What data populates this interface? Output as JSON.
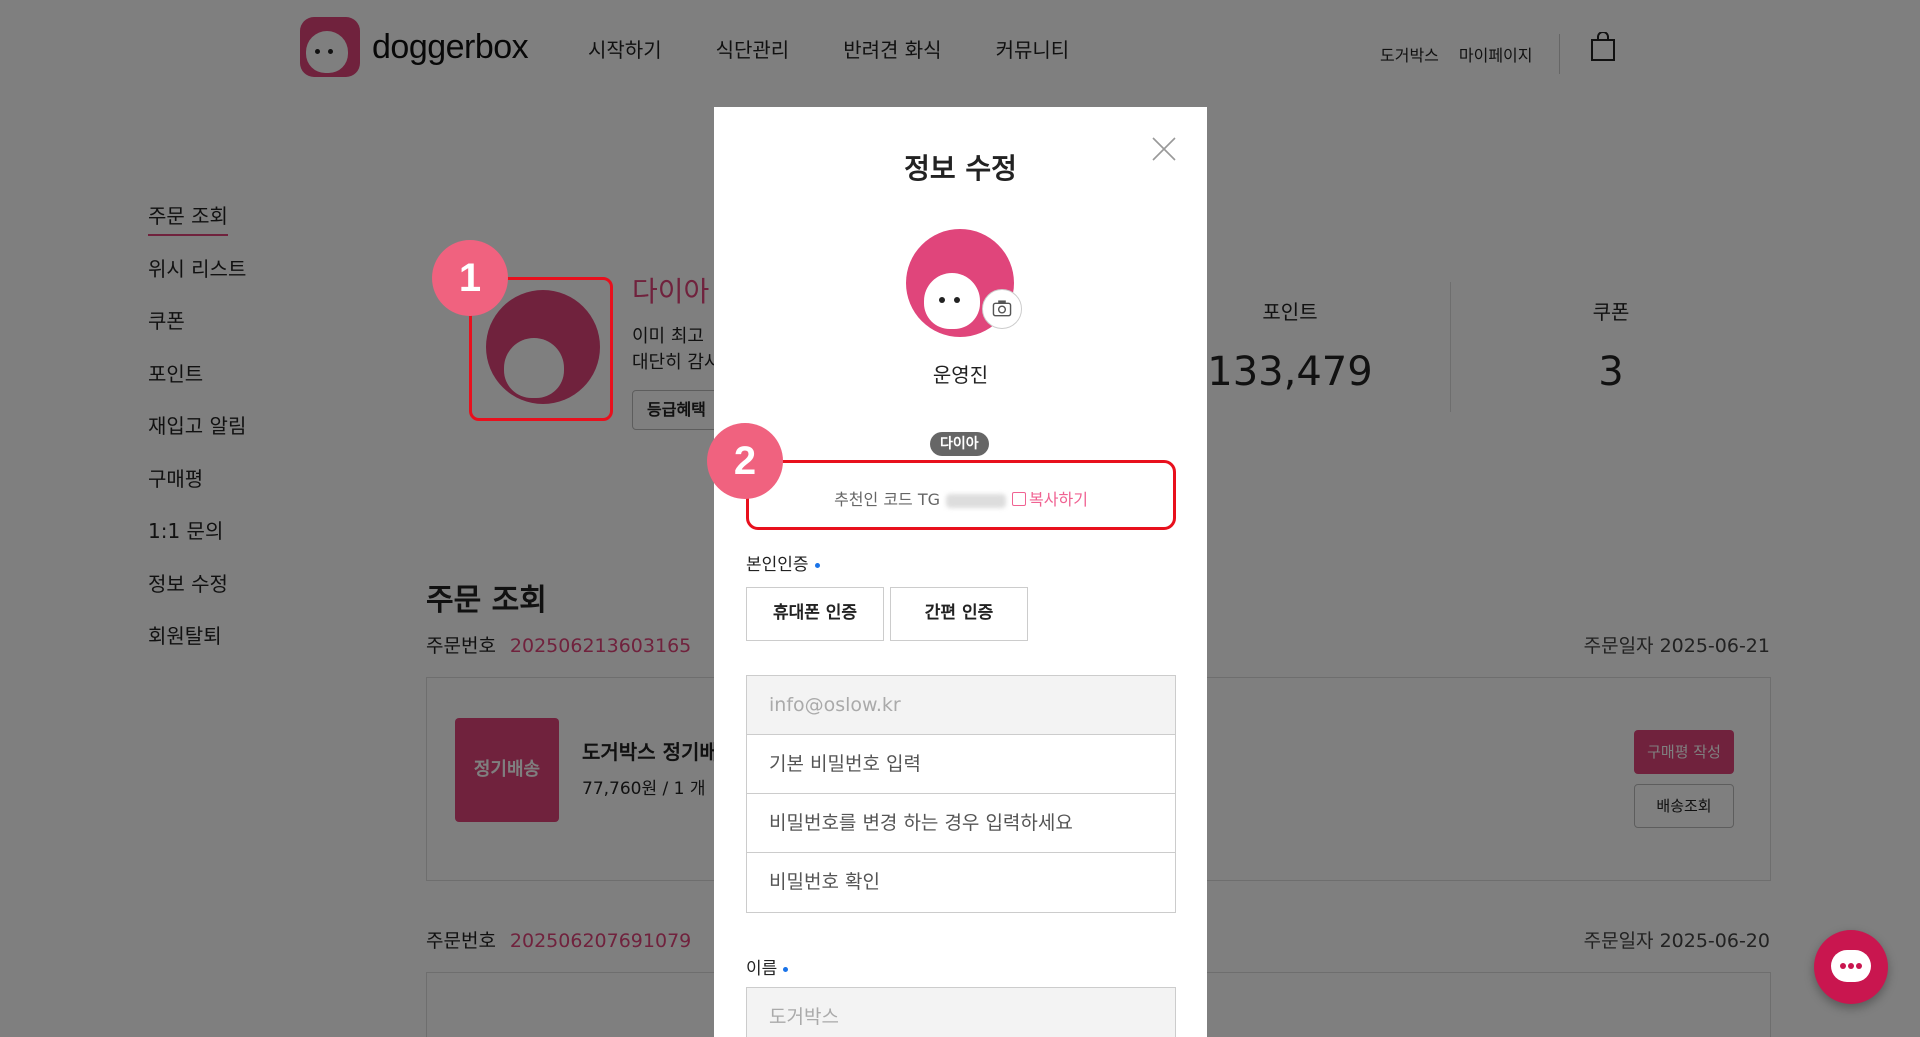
{
  "header": {
    "logo_text": "doggerbox",
    "nav": [
      "시작하기",
      "식단관리",
      "반려견 화식",
      "커뮤니티"
    ],
    "util": [
      "도거박스",
      "마이페이지"
    ]
  },
  "sidenav": [
    "주문 조회",
    "위시 리스트",
    "쿠폰",
    "포인트",
    "재입고 알림",
    "구매평",
    "1:1 문의",
    "정보 수정",
    "회원탈퇴"
  ],
  "profile": {
    "grade": "다이아",
    "desc1": "이미 최고",
    "desc2": "대단히 감사",
    "grade_button": "등급혜택"
  },
  "stats": [
    {
      "label": "포인트",
      "value": "133,479"
    },
    {
      "label": "쿠폰",
      "value": "3"
    }
  ],
  "orders": {
    "title": "주문 조회",
    "number_label": "주문번호",
    "items": [
      {
        "number": "202506213603165",
        "date": "주문일자 2025-06-21",
        "thumb": "정기배송",
        "name": "도거박스 정기배",
        "price": "77,760원 / 1 개",
        "review": "구매평 작성",
        "ship": "배송조회"
      },
      {
        "number": "202506207691079",
        "date": "주문일자 2025-06-20"
      }
    ]
  },
  "markers": [
    "1",
    "2"
  ],
  "modal": {
    "title": "정보 수정",
    "username": "운영진",
    "badge": "다이아",
    "referral_label": "추천인 코드 TG",
    "copy_label": "복사하기",
    "auth_label": "본인인증",
    "auth_buttons": [
      "휴대폰 인증",
      "간편 인증"
    ],
    "email": "info@oslow.kr",
    "password_placeholder": "기본 비밀번호 입력",
    "new_password_placeholder": "비밀번호를 변경 하는 경우 입력하세요",
    "confirm_placeholder": "비밀번호 확인",
    "name_label": "이름",
    "name_value": "도거박스"
  },
  "colors": {
    "brand": "#e0457b",
    "highlight": "#e8101d",
    "marker": "#f0627f"
  }
}
